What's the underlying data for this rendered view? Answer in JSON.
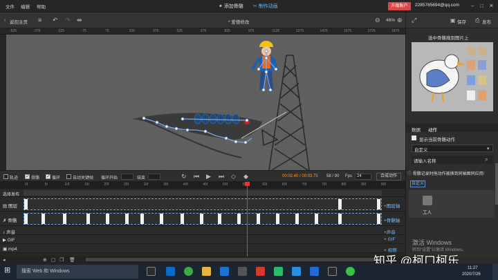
{
  "menu": {
    "items": [
      "文件",
      "编辑",
      "帮助"
    ],
    "mode_tabs": [
      "添加骨骼",
      "制作动画"
    ],
    "active_mode": 1,
    "upgrade": "升级账户",
    "account": "2285785694@qq.com"
  },
  "toolbar": {
    "back": "返回主页",
    "doc_title": "* 爱德修改",
    "zoom": "46%",
    "save": "保存",
    "publish": "发布"
  },
  "ruler": {
    "ticks": [
      "-525",
      "-375",
      "-225",
      "-75",
      "75",
      "225",
      "375",
      "525",
      "675",
      "825",
      "975",
      "1125",
      "1275",
      "1425",
      "1575",
      "1725",
      "1875"
    ]
  },
  "right_panel": {
    "preview_title": "选中骨骼拖到图片上",
    "tabs": [
      "数据",
      "动作"
    ],
    "active_tab": 1,
    "show_bone_action": "显示当前骨骼动作",
    "dropdown": "自定义",
    "search_placeholder": "请输入名称",
    "hint": "骨骼记录时拖动作被换到同轴图同应用!",
    "custom_tag": "自定义",
    "action_label": "工人"
  },
  "playbar": {
    "track_label": "轨迹",
    "bone_label": "骨骼",
    "loop_label": "循环",
    "auto_key_label": "自动关键帧",
    "loop_start": "循环开始",
    "end": "结束",
    "time": "00:02.40 / 00:03.75",
    "frame": "58 / 90",
    "fps_label": "Fps",
    "fps": "24",
    "compose": "合成动作"
  },
  "timeline": {
    "frames": [
      "0f",
      "5f",
      "10f",
      "15f",
      "20f",
      "25f",
      "30f",
      "35f",
      "40f",
      "45f",
      "50f",
      "55f",
      "60f",
      "65f",
      "70f",
      "75f",
      "80f",
      "85f",
      "90f"
    ],
    "publish_label": "选择发布"
  },
  "layers": [
    {
      "name": "图层",
      "add": "+图层轴"
    },
    {
      "name": "骨骼",
      "add": "+骨骼轴"
    },
    {
      "name": "声音",
      "add": "+声音"
    },
    {
      "name": "GIF",
      "add": "+ GIF"
    },
    {
      "name": "mp4",
      "add": "+ 视频"
    }
  ],
  "watermark": {
    "activate": "激活 Windows",
    "activate_sub": "转到“设置”以激活 Windows。",
    "zhihu": "知乎 @柯口柯乐"
  },
  "taskbar": {
    "search": "搜索 Web 和 Windows",
    "time": "11:27",
    "date": "2020/7/26"
  },
  "colors": {
    "accent": "#6fb5ff",
    "upgrade": "#d94848",
    "canvas": "#5f5f5f",
    "keyframe": "#f0f0f0"
  }
}
